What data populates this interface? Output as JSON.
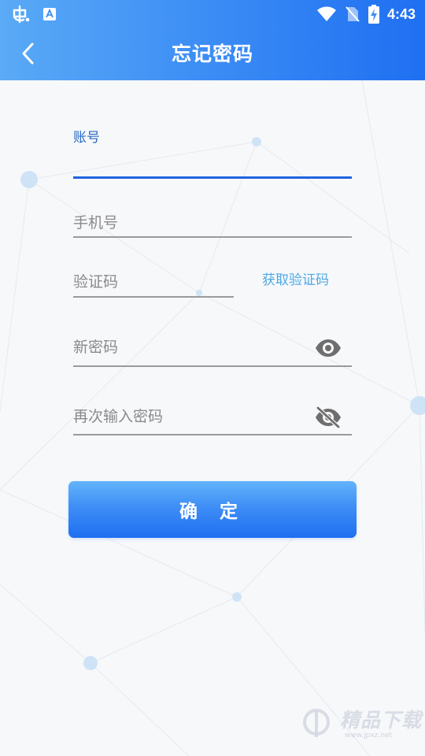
{
  "status_bar": {
    "time": "4:43",
    "icons": [
      "app-icon",
      "translate-icon",
      "wifi-icon",
      "no-sim-icon",
      "battery-charging-icon"
    ]
  },
  "header": {
    "title": "忘记密码",
    "back_icon": "chevron-left-icon"
  },
  "form": {
    "account": {
      "label": "账号",
      "value": ""
    },
    "phone": {
      "placeholder": "手机号",
      "value": ""
    },
    "code": {
      "placeholder": "验证码",
      "value": "",
      "get_code_label": "获取验证码"
    },
    "new_password": {
      "placeholder": "新密码",
      "value": "",
      "visibility_icon": "eye-icon"
    },
    "confirm_password": {
      "placeholder": "再次输入密码",
      "value": "",
      "visibility_icon": "eye-off-icon"
    },
    "submit_label": "确 定"
  },
  "watermark": {
    "text": "精品下载",
    "subtext": "www.jpxz.net"
  },
  "colors": {
    "accent": "#1e63df",
    "link": "#4ea8e6",
    "header_start": "#5aaaf6",
    "header_end": "#1f6ff2"
  }
}
